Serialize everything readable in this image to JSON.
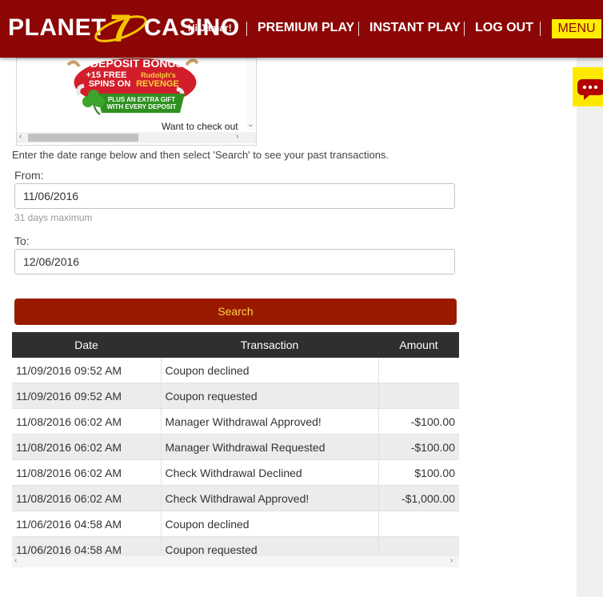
{
  "header": {
    "logo": {
      "left_word": "PLANET",
      "numeral": "7",
      "right_word": "CASINO"
    },
    "greeting": "Hi Jamar!",
    "nav": [
      {
        "label": "PREMIUM PLAY"
      },
      {
        "label": "INSTANT PLAY"
      },
      {
        "label": "LOG OUT"
      }
    ],
    "menu_label": "MENU",
    "colors": {
      "bar": "#8c0606",
      "menu_bg": "#ffed00"
    }
  },
  "chat_widget": {
    "icon": "chat-bubble-icon"
  },
  "banner": {
    "lines": [
      "DEPOSIT BONUS",
      "+15 FREE",
      "SPINS ON",
      "Rudolph's",
      "REVENGE",
      "PLUS AN EXTRA GIFT",
      "WITH EVERY DEPOSIT"
    ],
    "caption": "Want to check out"
  },
  "form": {
    "intro": "Enter the date range below and then select 'Search' to see your past transactions.",
    "from_label": "From:",
    "from_value": "11/06/2016",
    "hint": "31 days maximum",
    "to_label": "To:",
    "to_value": "12/06/2016",
    "search_label": "Search",
    "colors": {
      "button": "#9a1a00",
      "button_text": "#ffd34a"
    }
  },
  "table": {
    "headers": [
      "Date",
      "Transaction",
      "Amount"
    ],
    "rows": [
      [
        "11/09/2016 09:52 AM",
        "Coupon declined",
        ""
      ],
      [
        "11/09/2016 09:52 AM",
        "Coupon requested",
        ""
      ],
      [
        "11/08/2016 06:02 AM",
        "Manager Withdrawal Approved!",
        "-$100.00"
      ],
      [
        "11/08/2016 06:02 AM",
        "Manager Withdrawal Requested",
        "-$100.00"
      ],
      [
        "11/08/2016 06:02 AM",
        "Check Withdrawal Declined",
        "$100.00"
      ],
      [
        "11/08/2016 06:02 AM",
        "Check Withdrawal Approved!",
        "-$1,000.00"
      ],
      [
        "11/06/2016 04:58 AM",
        "Coupon declined",
        ""
      ],
      [
        "11/06/2016 04:58 AM",
        "Coupon requested",
        ""
      ]
    ]
  }
}
